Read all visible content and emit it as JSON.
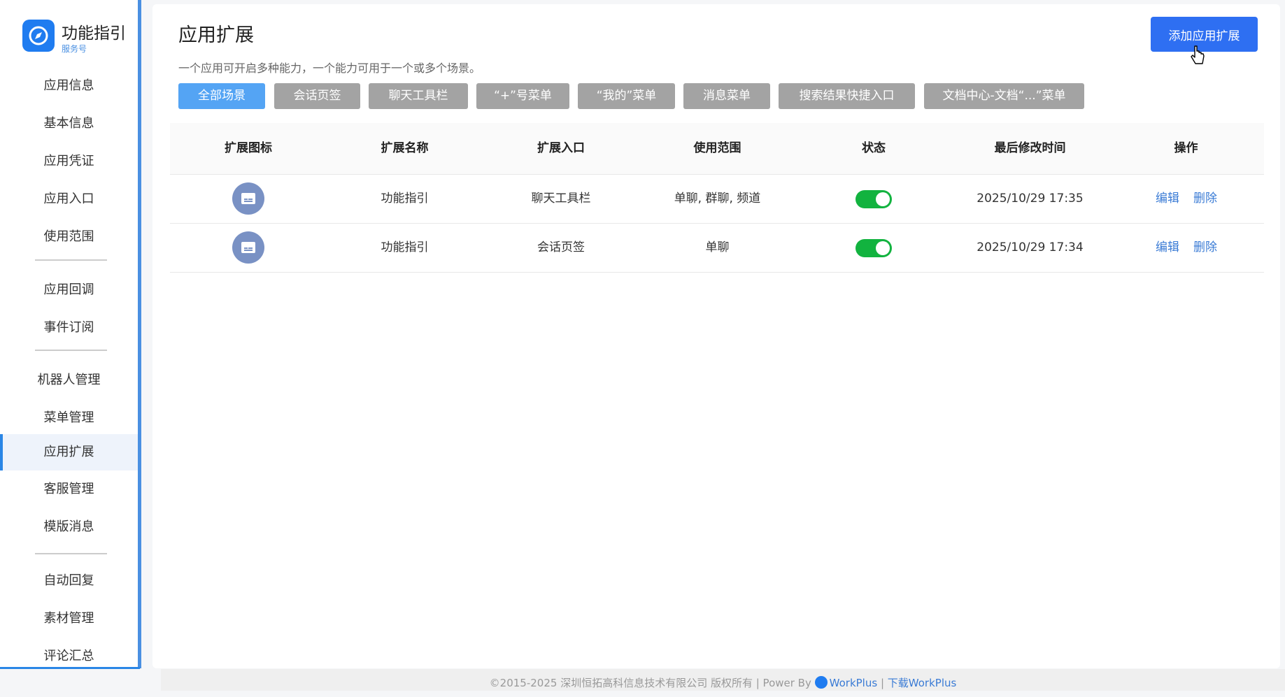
{
  "brand": {
    "title": "功能指引",
    "subtitle": "服务号",
    "logo_icon": "compass-icon"
  },
  "sidebar": {
    "items": [
      {
        "label": "应用信息"
      },
      {
        "label": "基本信息"
      },
      {
        "label": "应用凭证"
      },
      {
        "label": "应用入口"
      },
      {
        "label": "使用范围"
      },
      {
        "label": "应用回调"
      },
      {
        "label": "事件订阅"
      },
      {
        "label": "机器人管理"
      },
      {
        "label": "菜单管理"
      },
      {
        "label": "应用扩展",
        "active": true
      },
      {
        "label": "客服管理"
      },
      {
        "label": "模版消息"
      },
      {
        "label": "自动回复"
      },
      {
        "label": "素材管理"
      },
      {
        "label": "评论汇总"
      }
    ]
  },
  "main": {
    "title": "应用扩展",
    "subtitle": "一个应用可开启多种能力，一个能力可用于一个或多个场景。",
    "add_button": "添加应用扩展",
    "filters": [
      "全部场景",
      "会话页签",
      "聊天工具栏",
      "“+”号菜单",
      "“我的”菜单",
      "消息菜单",
      "搜索结果快捷入口",
      "文档中心-文档“...”菜单"
    ],
    "active_filter": "全部场景"
  },
  "table": {
    "headers": [
      "扩展图标",
      "扩展名称",
      "扩展入口",
      "使用范围",
      "状态",
      "最后修改时间",
      "操作"
    ],
    "rows": [
      {
        "icon": "extension-icon",
        "name": "功能指引",
        "entry": "聊天工具栏",
        "scope": "单聊, 群聊, 频道",
        "enabled": true,
        "modified": "2025/10/29 17:35",
        "edit": "编辑",
        "delete": "删除"
      },
      {
        "icon": "extension-icon",
        "name": "功能指引",
        "entry": "会话页签",
        "scope": "单聊",
        "enabled": true,
        "modified": "2025/10/29 17:34",
        "edit": "编辑",
        "delete": "删除"
      }
    ]
  },
  "footer": {
    "copyright": "©2015-2025 深圳恒拓高科信息技术有限公司 版权所有 | Power By",
    "powered_name": "WorkPlus",
    "separator": "|",
    "download": "下载WorkPlus"
  },
  "colors": {
    "accent": "#2e6ff2",
    "chip_active": "#54a4f4",
    "chip_inactive": "#a3a3a3",
    "toggle_on": "#12b33f",
    "link": "#3a7bd5"
  }
}
